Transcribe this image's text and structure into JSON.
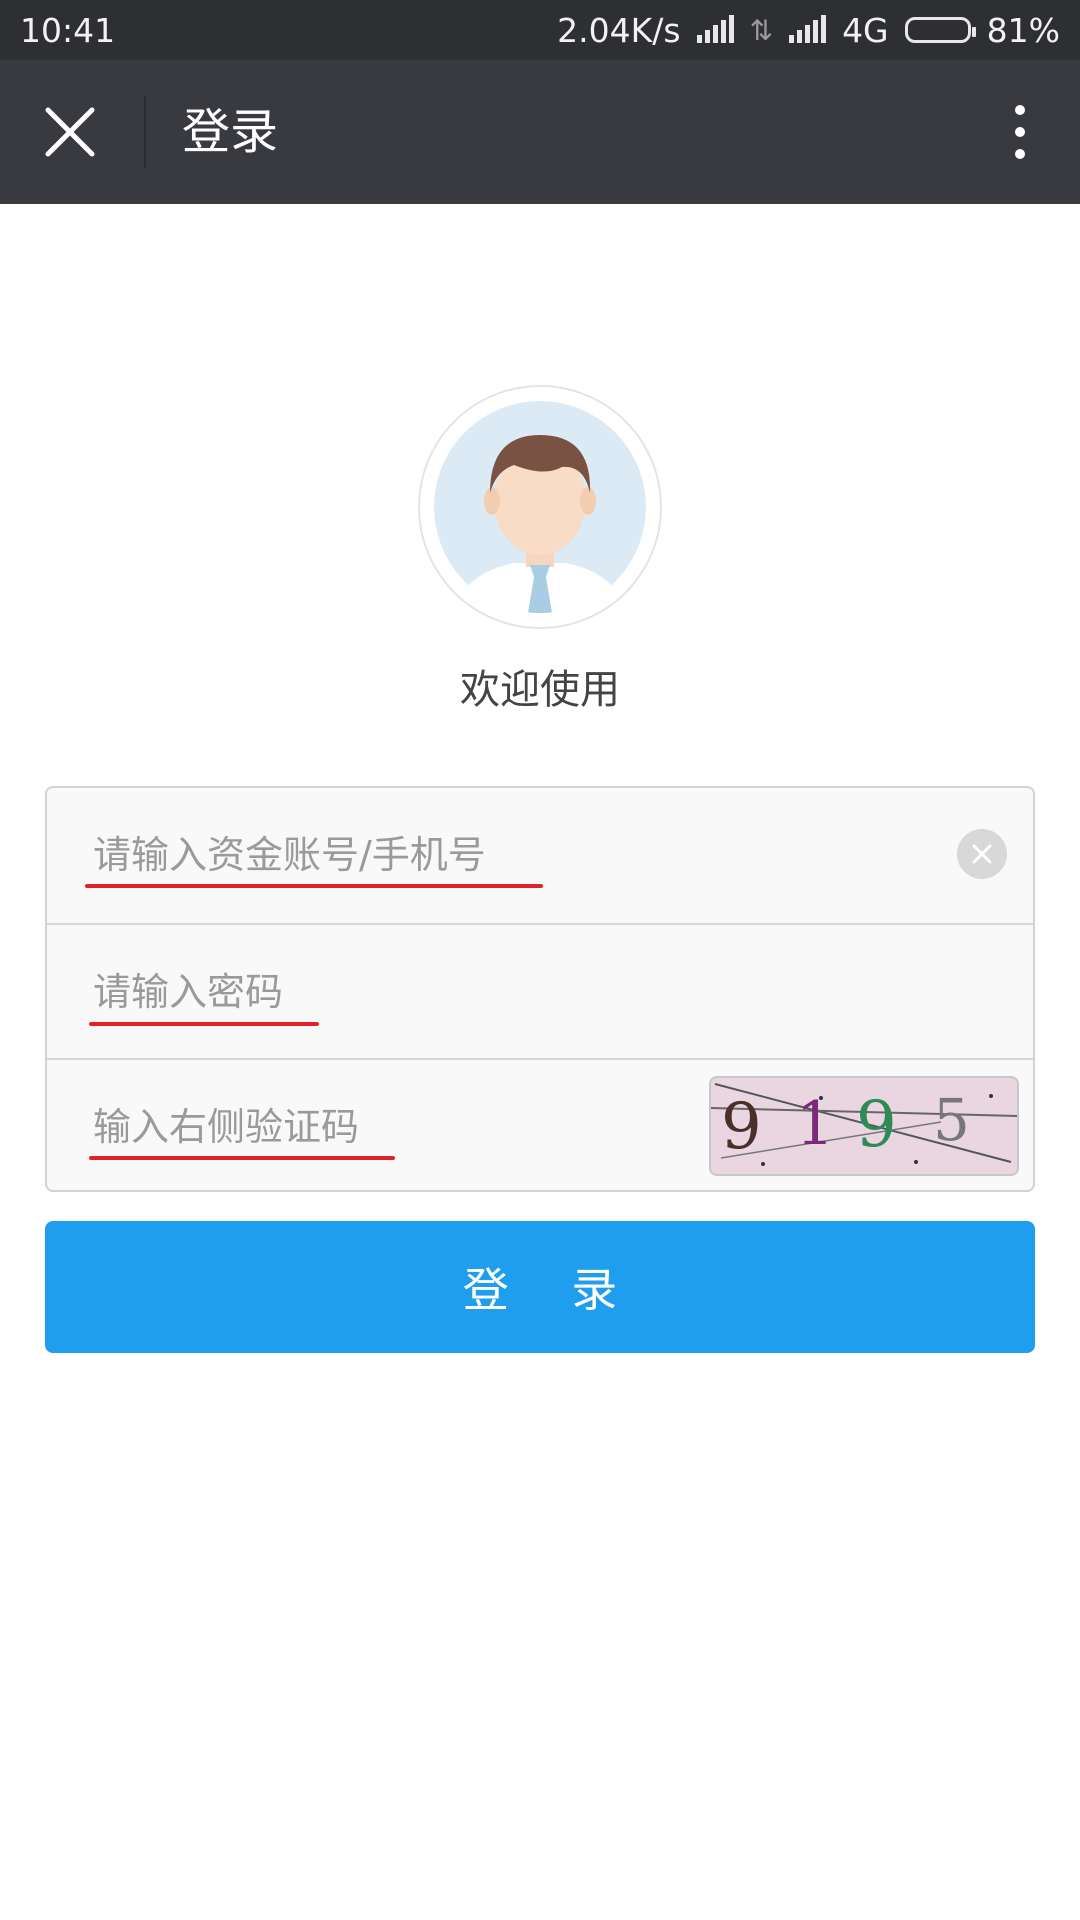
{
  "status_bar": {
    "time": "10:41",
    "net_speed": "2.04K/s",
    "network_type": "4G",
    "battery_percent": "81%",
    "battery_level": 0.81,
    "data_arrows_icon": "data-arrows-icon"
  },
  "nav": {
    "title": "登录",
    "close_icon": "close-icon",
    "more_icon": "more-vertical-icon",
    "background_color": "#393a3f"
  },
  "welcome": {
    "avatar_icon": "user-avatar-icon",
    "text": "欢迎使用"
  },
  "form": {
    "account_placeholder": "请输入资金账号/手机号",
    "password_placeholder": "请输入密码",
    "captcha_placeholder": "输入右侧验证码",
    "captcha_text": "9195",
    "clear_icon": "clear-icon",
    "underline_color": "#e0232b"
  },
  "login_button": {
    "label": "登 录",
    "color": "#1f9ef0"
  }
}
